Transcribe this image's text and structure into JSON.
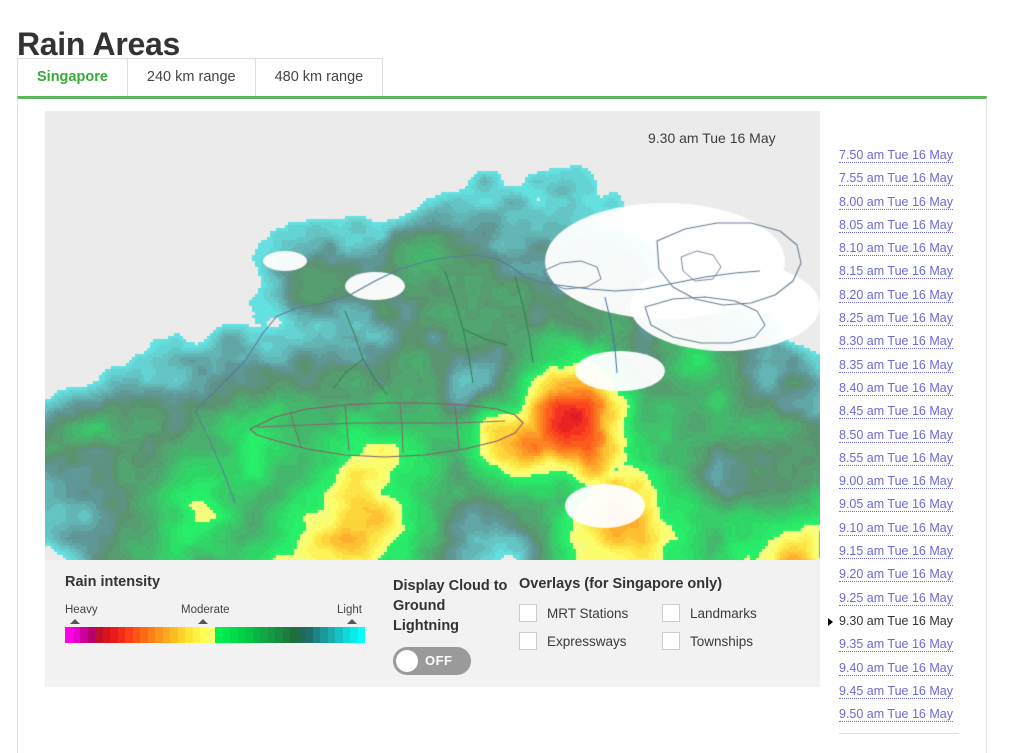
{
  "header": {
    "title": "Rain Areas"
  },
  "tabs": [
    {
      "label": "Singapore",
      "active": true
    },
    {
      "label": "240 km range",
      "active": false
    },
    {
      "label": "480 km range",
      "active": false
    }
  ],
  "radar": {
    "timestamp_overlay": "9.30 am Tue 16 May",
    "background_color": "#ebebeb"
  },
  "legend": {
    "title": "Rain intensity",
    "label_heavy": "Heavy",
    "label_moderate": "Moderate",
    "label_light": "Light",
    "colors": [
      "#ff00e6",
      "#e600cf",
      "#cc0099",
      "#b3006b",
      "#c2102a",
      "#d81220",
      "#e81a1a",
      "#f42a18",
      "#fa4015",
      "#fb5514",
      "#fc6a16",
      "#fd7f18",
      "#fe941b",
      "#ffa91e",
      "#ffbd22",
      "#ffd229",
      "#ffe432",
      "#fff243",
      "#fdff55",
      "#faff6a",
      "#00f050",
      "#00e84c",
      "#00dd49",
      "#00d145",
      "#06c444",
      "#0bb545",
      "#10a745",
      "#149944",
      "#178b42",
      "#1a7d3f",
      "#1e6f3c",
      "#1f6a55",
      "#1e6e6e",
      "#1d8383",
      "#1b9898",
      "#19adad",
      "#14c4c4",
      "#0fd9d9",
      "#0aeaea",
      "#00ffff"
    ]
  },
  "lightning": {
    "title": "Display Cloud to Ground Lightning",
    "state": "OFF"
  },
  "overlays": {
    "title": "Overlays (for Singapore only)",
    "items": [
      {
        "label": "MRT Stations",
        "checked": false
      },
      {
        "label": "Landmarks",
        "checked": false
      },
      {
        "label": "Expressways",
        "checked": false
      },
      {
        "label": "Townships",
        "checked": false
      }
    ]
  },
  "timestamps": {
    "selected": "9.30 am Tue 16 May",
    "items": [
      "7.50 am Tue 16 May",
      "7.55 am Tue 16 May",
      "8.00 am Tue 16 May",
      "8.05 am Tue 16 May",
      "8.10 am Tue 16 May",
      "8.15 am Tue 16 May",
      "8.20 am Tue 16 May",
      "8.25 am Tue 16 May",
      "8.30 am Tue 16 May",
      "8.35 am Tue 16 May",
      "8.40 am Tue 16 May",
      "8.45 am Tue 16 May",
      "8.50 am Tue 16 May",
      "8.55 am Tue 16 May",
      "9.00 am Tue 16 May",
      "9.05 am Tue 16 May",
      "9.10 am Tue 16 May",
      "9.15 am Tue 16 May",
      "9.20 am Tue 16 May",
      "9.25 am Tue 16 May",
      "9.30 am Tue 16 May",
      "9.35 am Tue 16 May",
      "9.40 am Tue 16 May",
      "9.45 am Tue 16 May",
      "9.50 am Tue 16 May"
    ]
  },
  "theme": {
    "accent_green": "#5cb85c",
    "tab_active_text": "#3aa93a",
    "link_purple": "#6a6ad8"
  }
}
